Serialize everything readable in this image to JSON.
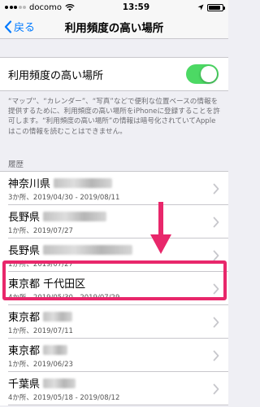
{
  "status": {
    "carrier": "docomo",
    "time": "13:59",
    "battery_level": 0.85
  },
  "nav": {
    "back_label": "戻る",
    "title": "利用頻度の高い場所"
  },
  "toggle": {
    "label": "利用頻度の高い場所",
    "on": true,
    "color": "#4cd964"
  },
  "footer_note": "“マップ”、“カレンダー”、“写真”などで便利な位置ベースの情報を提供するために、利用頻度の高い場所をiPhoneに登録することを許可します。“利用頻度の高い場所”の情報は暗号化されていてAppleはこの情報を読むことはできません。",
  "history": {
    "header": "履歴",
    "items": [
      {
        "title": "神奈川県",
        "subtitle": "3か所、2019/04/30 - 2019/08/11"
      },
      {
        "title": "長野県",
        "subtitle": "1か所、2019/07/27"
      },
      {
        "title": "長野県",
        "subtitle": "1か所、2019/07/27"
      },
      {
        "title": "東京都 千代田区",
        "subtitle": "4か所、2019/05/30 - 2019/07/29",
        "highlighted": true
      },
      {
        "title": "東京都",
        "subtitle": "1か所、2019/07/11"
      },
      {
        "title": "東京都",
        "subtitle": "1か所、2019/06/23"
      },
      {
        "title": "千葉県",
        "subtitle": "4か所、2019/05/18 - 2019/08/12"
      }
    ]
  },
  "annotation": {
    "highlight_color": "#e8276b"
  }
}
